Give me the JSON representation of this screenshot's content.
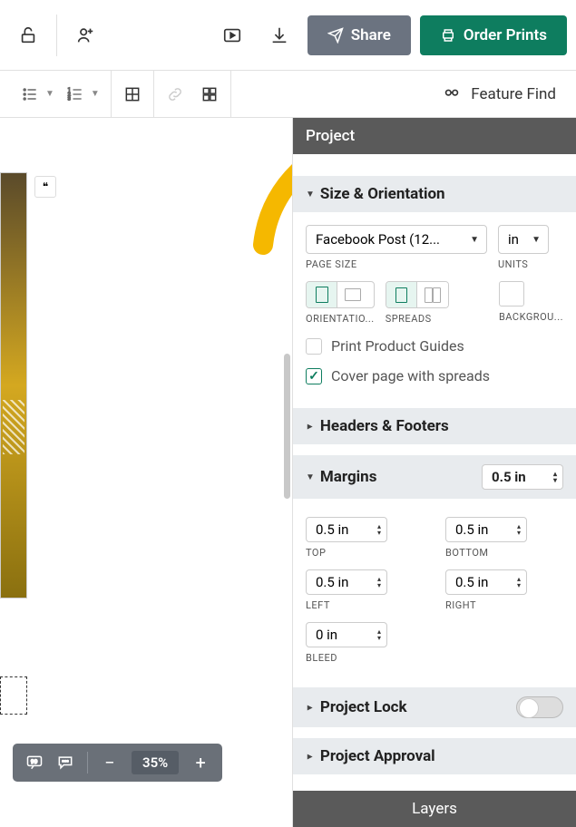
{
  "toolbar": {
    "share_label": "Share",
    "order_label": "Order Prints"
  },
  "subtoolbar": {
    "feature_find": "Feature Find"
  },
  "panel": {
    "project_title": "Project",
    "size_orientation": {
      "title": "Size & Orientation",
      "page_size_value": "Facebook Post (12...",
      "page_size_label": "PAGE SIZE",
      "units_value": "in",
      "units_label": "UNITS",
      "orientation_label": "ORIENTATIO...",
      "spreads_label": "SPREADS",
      "background_label": "BACKGROU...",
      "print_guides": "Print Product Guides",
      "cover_spreads": "Cover page with spreads"
    },
    "headers_footers": "Headers & Footers",
    "margins": {
      "title": "Margins",
      "default": "0.5 in",
      "top": "0.5 in",
      "top_label": "TOP",
      "bottom": "0.5 in",
      "bottom_label": "BOTTOM",
      "left": "0.5 in",
      "left_label": "LEFT",
      "right": "0.5 in",
      "right_label": "RIGHT",
      "bleed": "0 in",
      "bleed_label": "BLEED"
    },
    "project_lock": "Project Lock",
    "project_approval": "Project Approval",
    "layers_tab": "Layers"
  },
  "zoom": {
    "value": "35%"
  }
}
